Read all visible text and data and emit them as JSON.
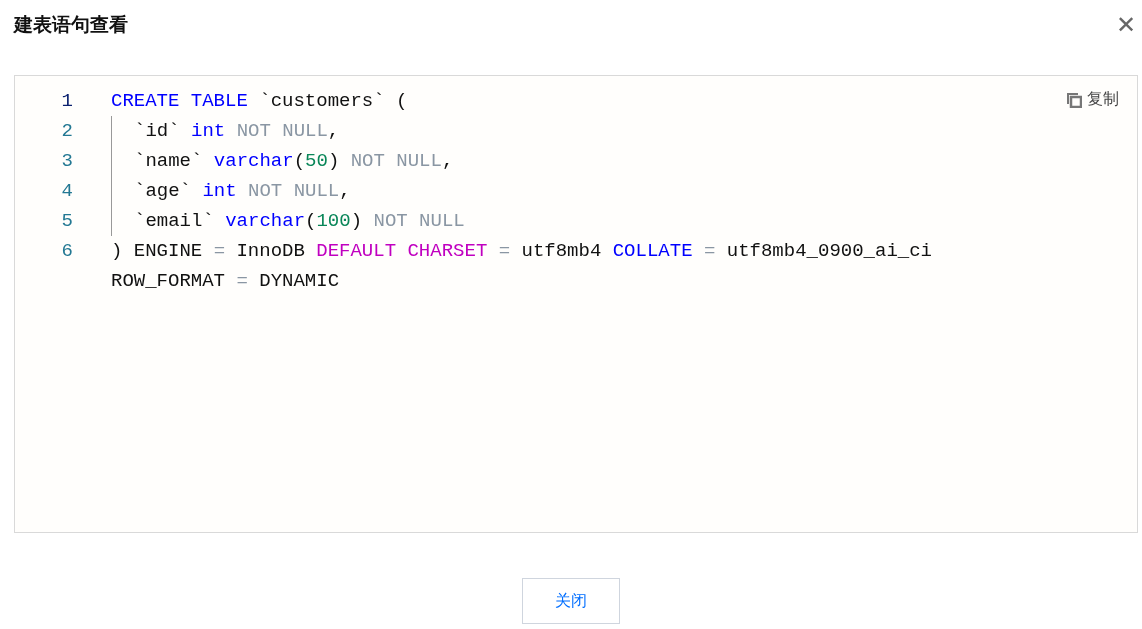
{
  "dialog": {
    "title": "建表语句查看",
    "close_icon": "✕"
  },
  "code": {
    "copy_label": "复制",
    "lines": [
      {
        "number": "1",
        "selected": true,
        "tokens": [
          {
            "kind": "keyword",
            "text": "CREATE TABLE"
          },
          {
            "kind": "plain",
            "text": " `customers` ("
          }
        ],
        "children": [
          {
            "number": "2",
            "selected": false,
            "tokens": [
              {
                "kind": "plain",
                "text": "`id` "
              },
              {
                "kind": "type",
                "text": "int"
              },
              {
                "kind": "muted",
                "text": " NOT NULL"
              },
              {
                "kind": "plain",
                "text": ","
              }
            ]
          },
          {
            "number": "3",
            "selected": false,
            "tokens": [
              {
                "kind": "plain",
                "text": "`name` "
              },
              {
                "kind": "type",
                "text": "varchar"
              },
              {
                "kind": "plain",
                "text": "("
              },
              {
                "kind": "number",
                "text": "50"
              },
              {
                "kind": "plain",
                "text": ")"
              },
              {
                "kind": "muted",
                "text": " NOT NULL"
              },
              {
                "kind": "plain",
                "text": ","
              }
            ]
          },
          {
            "number": "4",
            "selected": false,
            "tokens": [
              {
                "kind": "plain",
                "text": "`age` "
              },
              {
                "kind": "type",
                "text": "int"
              },
              {
                "kind": "muted",
                "text": " NOT NULL"
              },
              {
                "kind": "plain",
                "text": ","
              }
            ]
          },
          {
            "number": "5",
            "selected": false,
            "tokens": [
              {
                "kind": "plain",
                "text": "`email` "
              },
              {
                "kind": "type",
                "text": "varchar"
              },
              {
                "kind": "plain",
                "text": "("
              },
              {
                "kind": "number",
                "text": "100"
              },
              {
                "kind": "plain",
                "text": ")"
              },
              {
                "kind": "muted",
                "text": " NOT NULL"
              }
            ]
          }
        ]
      },
      {
        "number": "6",
        "selected": false,
        "tokens": [
          {
            "kind": "plain",
            "text": ") ENGINE "
          },
          {
            "kind": "muted",
            "text": "="
          },
          {
            "kind": "plain",
            "text": " InnoDB "
          },
          {
            "kind": "keyword2",
            "text": "DEFAULT CHARSET"
          },
          {
            "kind": "muted",
            "text": " ="
          },
          {
            "kind": "plain",
            "text": " utf8mb4 "
          },
          {
            "kind": "keyword",
            "text": "COLLATE"
          },
          {
            "kind": "muted",
            "text": " ="
          },
          {
            "kind": "plain",
            "text": " utf8mb4_0900_ai_ci ROW_FORMAT "
          },
          {
            "kind": "muted",
            "text": "="
          },
          {
            "kind": "plain",
            "text": " DYNAMIC"
          }
        ]
      }
    ]
  },
  "buttons": [
    {
      "label": "关闭"
    }
  ]
}
